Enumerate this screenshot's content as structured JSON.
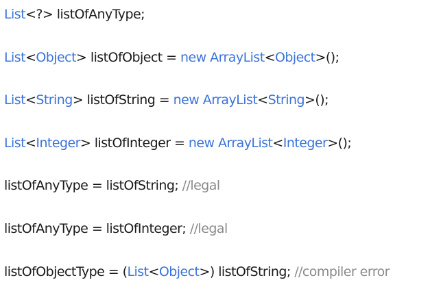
{
  "colors": {
    "keyword": "#3b73d9",
    "text": "#1a1a1a",
    "comment": "#8a8a8a",
    "background": "#ffffff"
  },
  "lines": [
    [
      {
        "t": "type",
        "v": "List"
      },
      {
        "t": "plain",
        "v": "<?> listOfAnyType;"
      }
    ],
    [
      {
        "t": "type",
        "v": "List"
      },
      {
        "t": "plain",
        "v": "<"
      },
      {
        "t": "type",
        "v": "Object"
      },
      {
        "t": "plain",
        "v": "> listOfObject = "
      },
      {
        "t": "kw",
        "v": "new"
      },
      {
        "t": "plain",
        "v": " "
      },
      {
        "t": "type",
        "v": "ArrayList"
      },
      {
        "t": "plain",
        "v": "<"
      },
      {
        "t": "type",
        "v": "Object"
      },
      {
        "t": "plain",
        "v": ">();"
      }
    ],
    [
      {
        "t": "type",
        "v": "List"
      },
      {
        "t": "plain",
        "v": "<"
      },
      {
        "t": "type",
        "v": "String"
      },
      {
        "t": "plain",
        "v": "> listOfString = "
      },
      {
        "t": "kw",
        "v": "new"
      },
      {
        "t": "plain",
        "v": " "
      },
      {
        "t": "type",
        "v": "ArrayList"
      },
      {
        "t": "plain",
        "v": "<"
      },
      {
        "t": "type",
        "v": "String"
      },
      {
        "t": "plain",
        "v": ">();"
      }
    ],
    [
      {
        "t": "type",
        "v": "List"
      },
      {
        "t": "plain",
        "v": "<"
      },
      {
        "t": "type",
        "v": "Integer"
      },
      {
        "t": "plain",
        "v": "> listOfInteger = "
      },
      {
        "t": "kw",
        "v": "new"
      },
      {
        "t": "plain",
        "v": " "
      },
      {
        "t": "type",
        "v": "ArrayList"
      },
      {
        "t": "plain",
        "v": "<"
      },
      {
        "t": "type",
        "v": "Integer"
      },
      {
        "t": "plain",
        "v": ">();"
      }
    ],
    [
      {
        "t": "plain",
        "v": "listOfAnyType = listOfString; "
      },
      {
        "t": "comment",
        "v": "//legal"
      }
    ],
    [
      {
        "t": "plain",
        "v": "listOfAnyType = listOfInteger; "
      },
      {
        "t": "comment",
        "v": "//legal"
      }
    ],
    [
      {
        "t": "plain",
        "v": "listOfObjectType = ("
      },
      {
        "t": "type",
        "v": "List"
      },
      {
        "t": "plain",
        "v": "<"
      },
      {
        "t": "type",
        "v": "Object"
      },
      {
        "t": "plain",
        "v": ">) listOfString; "
      },
      {
        "t": "comment",
        "v": "//compiler error"
      }
    ]
  ]
}
